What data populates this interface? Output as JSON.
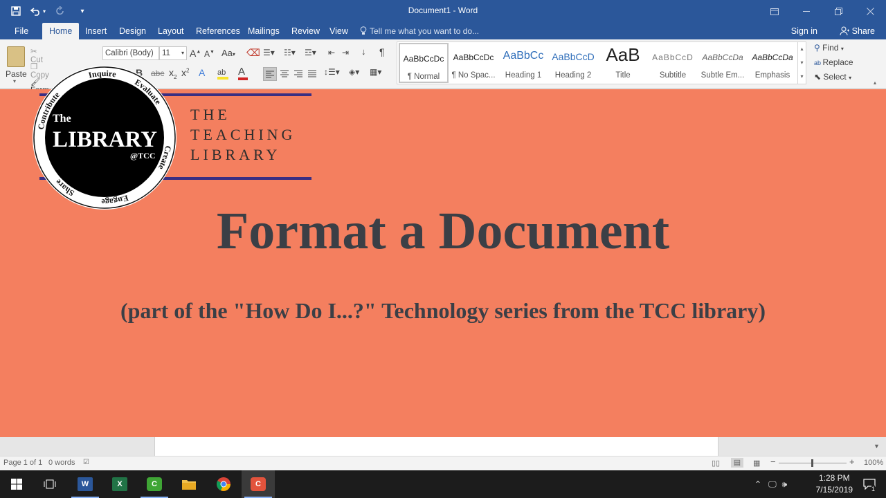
{
  "window": {
    "title": "Document1 - Word",
    "quick_access": {
      "save": "save-icon",
      "undo": "undo-icon",
      "redo": "redo-icon",
      "customize": "customize-qat-icon"
    }
  },
  "menu": {
    "tabs": [
      "File",
      "Home",
      "Insert",
      "Design",
      "Layout",
      "References",
      "Mailings",
      "Review",
      "View"
    ],
    "active_tab": "Home",
    "tell_me": "Tell me what you want to do...",
    "sign_in": "Sign in",
    "share": "Share"
  },
  "ribbon": {
    "clipboard": {
      "paste": "Paste",
      "cut": "Cut",
      "copy": "Copy",
      "format_painter": "Form"
    },
    "font": {
      "name": "Calibri (Body)",
      "size": "11",
      "grow": "A",
      "shrink": "A",
      "case": "Aa",
      "bold": "B",
      "subscript": "x",
      "superscript": "x"
    },
    "styles": [
      {
        "sample": "AaBbCcDc",
        "name": "¶ Normal"
      },
      {
        "sample": "AaBbCcDc",
        "name": "¶ No Spac..."
      },
      {
        "sample": "AaBbCc",
        "name": "Heading 1"
      },
      {
        "sample": "AaBbCcD",
        "name": "Heading 2"
      },
      {
        "sample": "AaB",
        "name": "Title"
      },
      {
        "sample": "AaBbCcD",
        "name": "Subtitle"
      },
      {
        "sample": "AaBbCcDa",
        "name": "Subtle Em..."
      },
      {
        "sample": "AaBbCcDa",
        "name": "Emphasis"
      }
    ],
    "editing": {
      "find": "Find",
      "replace": "Replace",
      "select": "Select"
    }
  },
  "document": {
    "logo": {
      "the": "The",
      "library": "LIBRARY",
      "at": "@TCC",
      "ring_words": [
        "Inquire",
        "Evaluate",
        "Create",
        "Engage",
        "Share",
        "Contribute"
      ]
    },
    "teaching_library": [
      "THE",
      "TEACHING",
      "LIBRARY"
    ],
    "heading": "Format a Document",
    "subheading": "(part of  the \"How Do I...?\" Technology series from the TCC library)"
  },
  "status": {
    "page": "Page 1 of 1",
    "words": "0 words",
    "zoom": "100%"
  },
  "taskbar": {
    "time": "1:28 PM",
    "date": "7/15/2019",
    "notification_count": "1",
    "apps": [
      "start-icon",
      "task-view-icon",
      "word-icon",
      "excel-icon",
      "camtasia-icon",
      "file-explorer-icon",
      "chrome-icon",
      "camtasia-recorder-icon"
    ]
  },
  "colors": {
    "word_blue": "#2b579a",
    "doc_background": "#f47f5f",
    "title_text": "#3b3f46",
    "logo_line": "#3a2e82"
  }
}
